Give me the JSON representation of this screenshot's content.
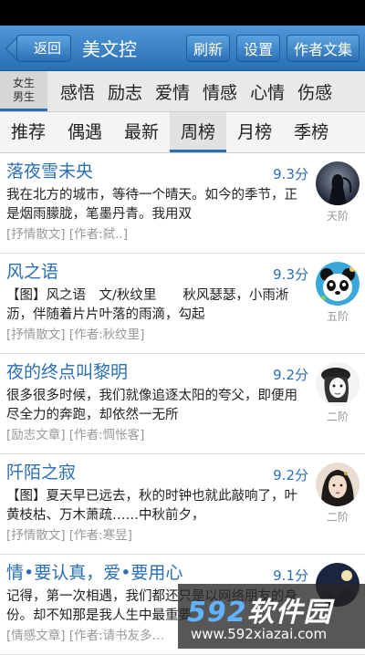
{
  "header": {
    "back_label": "返回",
    "title": "美文控",
    "buttons": [
      "刷新",
      "设置",
      "作者文集"
    ]
  },
  "categories": {
    "gender_top": "女生",
    "gender_bottom": "男生",
    "items": [
      "感悟",
      "励志",
      "爱情",
      "情感",
      "心情",
      "伤感"
    ]
  },
  "tabs": {
    "items": [
      "推荐",
      "偶遇",
      "最新",
      "周榜",
      "月榜",
      "季榜"
    ],
    "active": "周榜"
  },
  "articles": [
    {
      "title": "落夜雪未央",
      "score": "9.3分",
      "excerpt": "我在北方的城市，等待一个晴天。如今的季节，正是烟雨朦胧，笔墨丹青。我用双",
      "meta": "[抒情散文] [作者:弑..]",
      "rank": "天阶",
      "avatar_icon": "dark-figure-avatar-icon"
    },
    {
      "title": "风之语",
      "score": "9.3分",
      "excerpt": "【图】风之语　文/秋纹里　　秋风瑟瑟，小雨淅沥，伴随着片片叶落的雨滴，勾起",
      "meta": "[抒情散文] [作者:秋纹里]",
      "rank": "五阶",
      "avatar_icon": "panda-avatar-icon"
    },
    {
      "title": "夜的终点叫黎明",
      "score": "9.2分",
      "excerpt": "很多很多时候，我们就像追逐太阳的夸父，即便用尽全力的奔跑，却依然一无所",
      "meta": "[励志文章] [作者:惆怅客]",
      "rank": "二阶",
      "avatar_icon": "sketch-girl-avatar-icon"
    },
    {
      "title": "阡陌之寂",
      "score": "9.2分",
      "excerpt": "【图】夏天早已远去，秋的时钟也就此敲响了，叶黄枝枯、万木萧疏……中秋前夕，",
      "meta": "[抒情散文] [作者:寒昱]",
      "rank": "二阶",
      "avatar_icon": "costume-woman-avatar-icon"
    },
    {
      "title": "情•要认真，爱•要用心",
      "score": "9.1分",
      "excerpt": "记得，第一次相遇，我们都还只是以网络朋友的身份。却不知那是我人生中最重要",
      "meta": "[情感文章] [作者:请书友多…",
      "rank": "",
      "avatar_icon": "night-scene-avatar-icon"
    }
  ],
  "watermark": {
    "logo_num": "592",
    "logo_text": "软件园",
    "url": "www.592xiazai.com"
  }
}
